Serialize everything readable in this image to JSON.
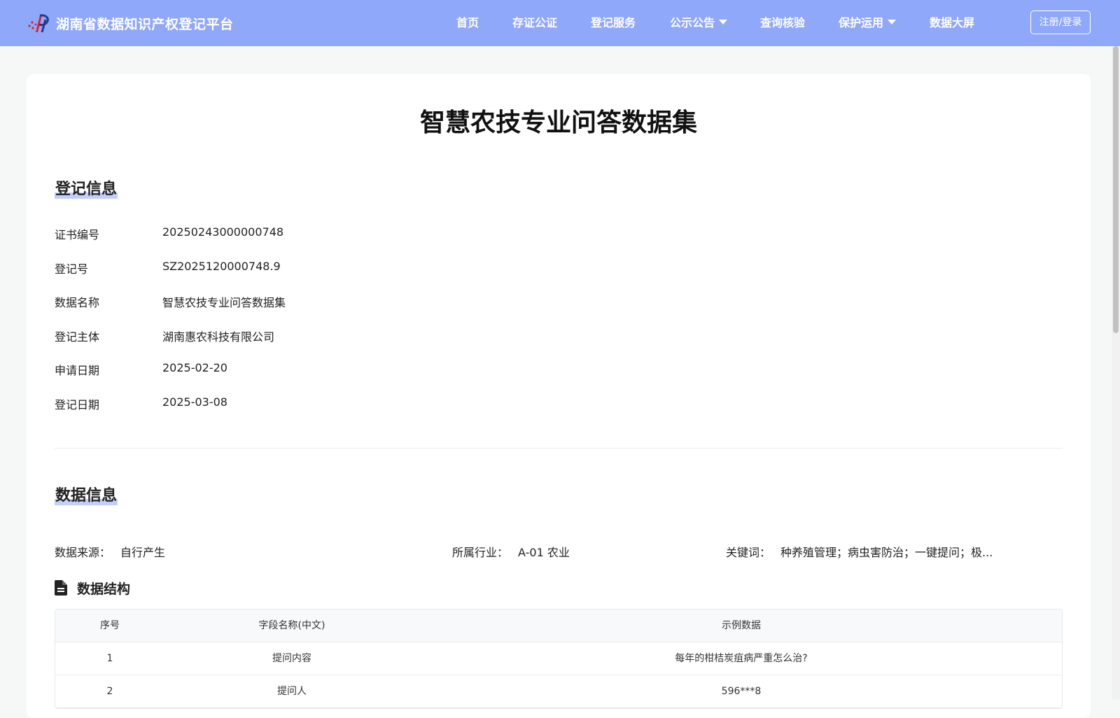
{
  "header": {
    "title": "湖南省数据知识产权登记平台",
    "nav": [
      {
        "label": "首页",
        "dropdown": false
      },
      {
        "label": "存证公证",
        "dropdown": false
      },
      {
        "label": "登记服务",
        "dropdown": false
      },
      {
        "label": "公示公告",
        "dropdown": true
      },
      {
        "label": "查询核验",
        "dropdown": false
      },
      {
        "label": "保护运用",
        "dropdown": true
      },
      {
        "label": "数据大屏",
        "dropdown": false
      }
    ],
    "login_label": "注册/登录",
    "colors": {
      "bar": "#90a8fa",
      "text": "#ffffff"
    }
  },
  "page": {
    "title": "智慧农技专业问答数据集"
  },
  "registration": {
    "section_title": "登记信息",
    "rows": [
      {
        "label": "证书编号",
        "value": "20250243000000748"
      },
      {
        "label": "登记号",
        "value": "SZ2025120000748.9"
      },
      {
        "label": "数据名称",
        "value": "智慧农技专业问答数据集"
      },
      {
        "label": "登记主体",
        "value": "湖南惠农科技有限公司"
      },
      {
        "label": "申请日期",
        "value": "2025-02-20"
      },
      {
        "label": "登记日期",
        "value": "2025-03-08"
      }
    ]
  },
  "data_info": {
    "section_title": "数据信息",
    "source_label": "数据来源：",
    "source_value": "自行产生",
    "industry_label": "所属行业：",
    "industry_value": "A-01 农业",
    "keywords_label": "关键词：",
    "keywords_value": "种养殖管理；病虫害防治；一键提问；极..."
  },
  "structure": {
    "title": "数据结构",
    "icon": "document-icon",
    "headers": [
      "序号",
      "字段名称(中文)",
      "示例数据"
    ],
    "rows": [
      [
        "1",
        "提问内容",
        "每年的柑桔炭疽病严重怎么治?"
      ],
      [
        "2",
        "提问人",
        "596***8"
      ]
    ]
  }
}
